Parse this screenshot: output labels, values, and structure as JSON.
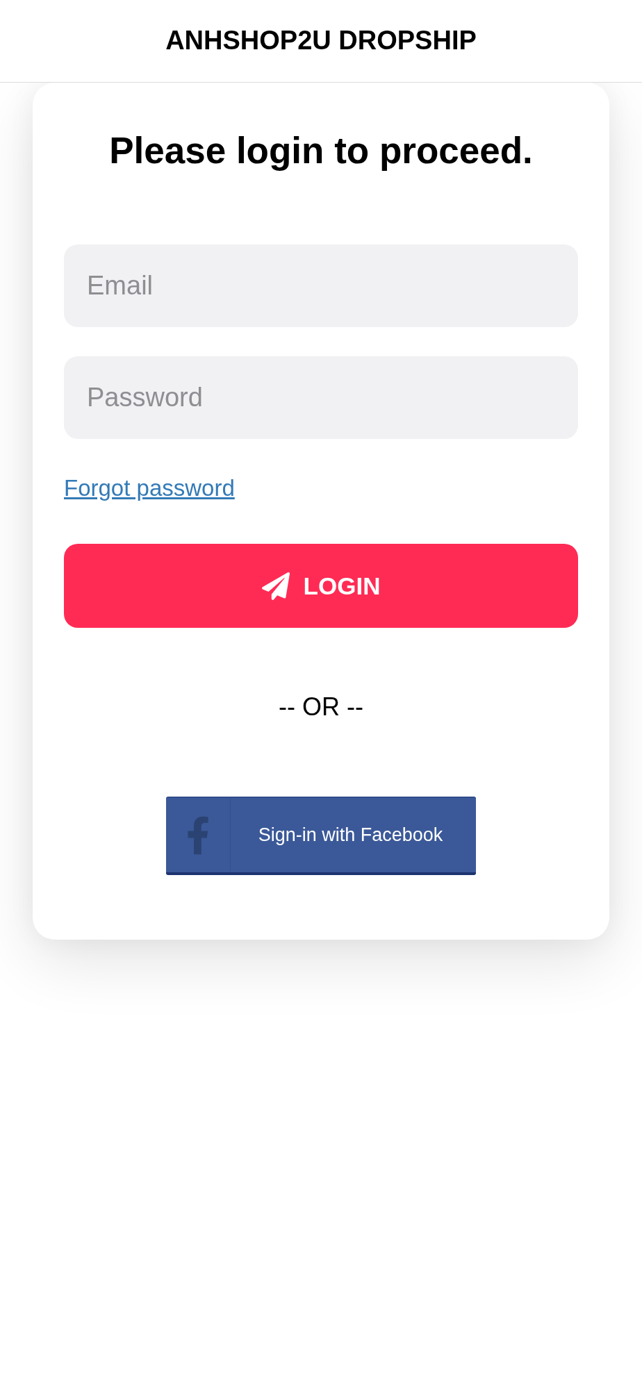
{
  "header": {
    "title": "ANHSHOP2U DROPSHIP"
  },
  "login_card": {
    "heading": "Please login to proceed.",
    "email_field": {
      "placeholder": "Email"
    },
    "password_field": {
      "placeholder": "Password"
    },
    "forgot_link": "Forgot password",
    "login_button": "LOGIN",
    "separator": "-- OR --",
    "facebook_button": "Sign-in with Facebook"
  }
}
